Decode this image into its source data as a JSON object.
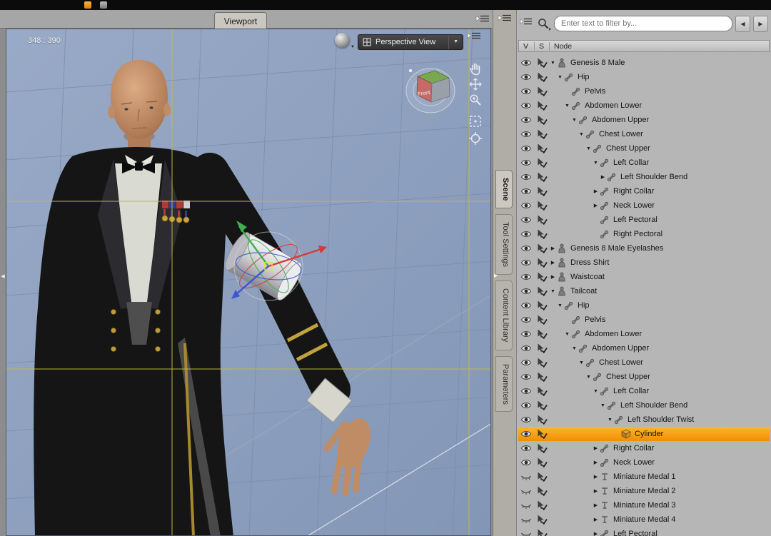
{
  "titlebar": {
    "icons": [
      "orange-app-icon",
      "gray-app-icon"
    ]
  },
  "viewport": {
    "tab_label": "Viewport",
    "size_readout": "348 : 390",
    "view_selector_label": "Perspective View",
    "view_cube_front_label": "Front",
    "tools": [
      "pan-hand",
      "move",
      "zoom",
      "frame",
      "aim"
    ]
  },
  "side_tabs": [
    {
      "label": "Scene",
      "selected": true
    },
    {
      "label": "Tool Settings",
      "selected": false
    },
    {
      "label": "Content Library",
      "selected": false
    },
    {
      "label": "Parameters",
      "selected": false
    }
  ],
  "scene_panel": {
    "filter_placeholder": "Enter text to filter by...",
    "nav": {
      "prev_icon": "◀",
      "next_icon": "▶"
    },
    "columns": [
      "V",
      "S",
      "Node"
    ],
    "rows": [
      {
        "label": "Genesis 8 Male",
        "depth": 0,
        "expand": "open",
        "icon": "figure",
        "eye": "open"
      },
      {
        "label": "Hip",
        "depth": 1,
        "expand": "open",
        "icon": "bone",
        "eye": "open"
      },
      {
        "label": "Pelvis",
        "depth": 2,
        "expand": "none",
        "icon": "bone",
        "eye": "open"
      },
      {
        "label": "Abdomen Lower",
        "depth": 2,
        "expand": "open",
        "icon": "bone",
        "eye": "open"
      },
      {
        "label": "Abdomen Upper",
        "depth": 3,
        "expand": "open",
        "icon": "bone",
        "eye": "open"
      },
      {
        "label": "Chest Lower",
        "depth": 4,
        "expand": "open",
        "icon": "bone",
        "eye": "open"
      },
      {
        "label": "Chest Upper",
        "depth": 5,
        "expand": "open",
        "icon": "bone",
        "eye": "open"
      },
      {
        "label": "Left Collar",
        "depth": 6,
        "expand": "open",
        "icon": "bone",
        "eye": "open"
      },
      {
        "label": "Left Shoulder Bend",
        "depth": 7,
        "expand": "closed",
        "icon": "bone",
        "eye": "open"
      },
      {
        "label": "Right Collar",
        "depth": 6,
        "expand": "closed",
        "icon": "bone",
        "eye": "open"
      },
      {
        "label": "Neck Lower",
        "depth": 6,
        "expand": "closed",
        "icon": "bone",
        "eye": "open"
      },
      {
        "label": "Left Pectoral",
        "depth": 6,
        "expand": "none",
        "icon": "bone",
        "eye": "open"
      },
      {
        "label": "Right Pectoral",
        "depth": 6,
        "expand": "none",
        "icon": "bone",
        "eye": "open"
      },
      {
        "label": "Genesis 8 Male Eyelashes",
        "depth": 0,
        "expand": "closed",
        "icon": "figure",
        "eye": "open"
      },
      {
        "label": "Dress Shirt",
        "depth": 0,
        "expand": "closed",
        "icon": "figure",
        "eye": "open"
      },
      {
        "label": "Waistcoat",
        "depth": 0,
        "expand": "closed",
        "icon": "figure",
        "eye": "open"
      },
      {
        "label": "Tailcoat",
        "depth": 0,
        "expand": "open",
        "icon": "figure",
        "eye": "open"
      },
      {
        "label": "Hip",
        "depth": 1,
        "expand": "open",
        "icon": "bone",
        "eye": "open"
      },
      {
        "label": "Pelvis",
        "depth": 2,
        "expand": "none",
        "icon": "bone",
        "eye": "open"
      },
      {
        "label": "Abdomen Lower",
        "depth": 2,
        "expand": "open",
        "icon": "bone",
        "eye": "open"
      },
      {
        "label": "Abdomen Upper",
        "depth": 3,
        "expand": "open",
        "icon": "bone",
        "eye": "open"
      },
      {
        "label": "Chest Lower",
        "depth": 4,
        "expand": "open",
        "icon": "bone",
        "eye": "open"
      },
      {
        "label": "Chest Upper",
        "depth": 5,
        "expand": "open",
        "icon": "bone",
        "eye": "open"
      },
      {
        "label": "Left Collar",
        "depth": 6,
        "expand": "open",
        "icon": "bone",
        "eye": "open"
      },
      {
        "label": "Left Shoulder Bend",
        "depth": 7,
        "expand": "open",
        "icon": "bone",
        "eye": "open"
      },
      {
        "label": "Left Shoulder Twist",
        "depth": 8,
        "expand": "open",
        "icon": "bone",
        "eye": "open"
      },
      {
        "label": "Cylinder",
        "depth": 9,
        "expand": "none",
        "icon": "cube",
        "eye": "open",
        "selected": true
      },
      {
        "label": "Right Collar",
        "depth": 6,
        "expand": "closed",
        "icon": "bone",
        "eye": "open"
      },
      {
        "label": "Neck Lower",
        "depth": 6,
        "expand": "closed",
        "icon": "bone",
        "eye": "open"
      },
      {
        "label": "Miniature Medal 1",
        "depth": 6,
        "expand": "closed",
        "icon": "prop",
        "eye": "closed"
      },
      {
        "label": "Miniature Medal 2",
        "depth": 6,
        "expand": "closed",
        "icon": "prop",
        "eye": "closed"
      },
      {
        "label": "Miniature Medal 3",
        "depth": 6,
        "expand": "closed",
        "icon": "prop",
        "eye": "closed"
      },
      {
        "label": "Miniature Medal 4",
        "depth": 6,
        "expand": "closed",
        "icon": "prop",
        "eye": "closed"
      },
      {
        "label": "Left Pectoral",
        "depth": 6,
        "expand": "closed",
        "icon": "bone",
        "eye": "closed"
      }
    ]
  },
  "colors": {
    "selection_orange": "#F39A12",
    "viewport_bg": "#8FA1C0",
    "guide_yellow": "#BDBF3C"
  }
}
